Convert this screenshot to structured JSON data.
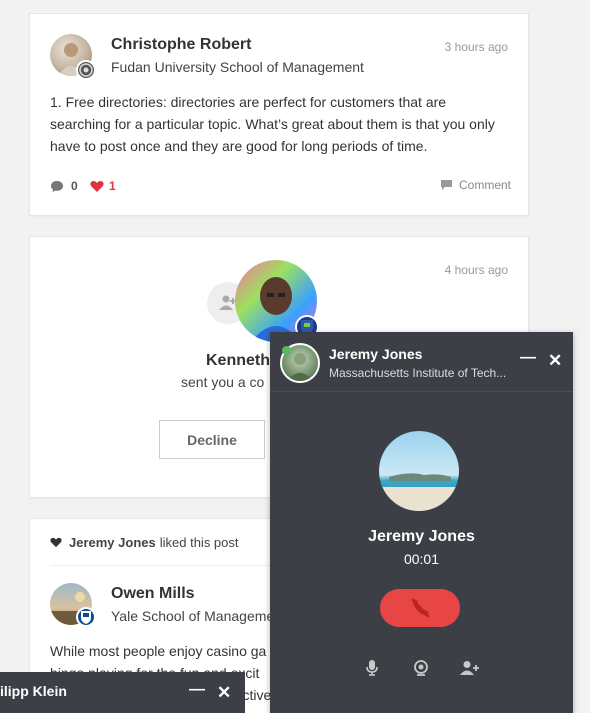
{
  "posts": [
    {
      "author": "Christophe Robert",
      "org": "Fudan University School of Management",
      "time": "3 hours ago",
      "text": "1. Free directories: directories are perfect for customers that are searching for a particular topic. What’s great about them is that you only have to post once and they are good for long periods of time.",
      "comments_count": "0",
      "likes_count": "1",
      "comment_label": "Comment"
    },
    {
      "liked_by": "Jeremy Jones",
      "liked_suffix": "liked this post",
      "author": "Owen Mills",
      "org": "Yale School of Management",
      "text_line1": "While most people enjoy casino ga",
      "text_line2": "bingo playing for the fun and excit",
      "text_line3": "addictive"
    }
  ],
  "connection_request": {
    "time": "4 hours ago",
    "name": "Kenneth",
    "message": "sent you a co",
    "decline_label": "Decline"
  },
  "call": {
    "header_name": "Jeremy Jones",
    "header_org": "Massachusetts Institute of Tech...",
    "callee_name": "Jeremy Jones",
    "duration": "00:01",
    "hangup_color": "#e84545"
  },
  "chat_bar": {
    "name": "ilipp Klein"
  },
  "colors": {
    "like_heart": "#e0323f",
    "call_bg": "#3d3f46"
  }
}
